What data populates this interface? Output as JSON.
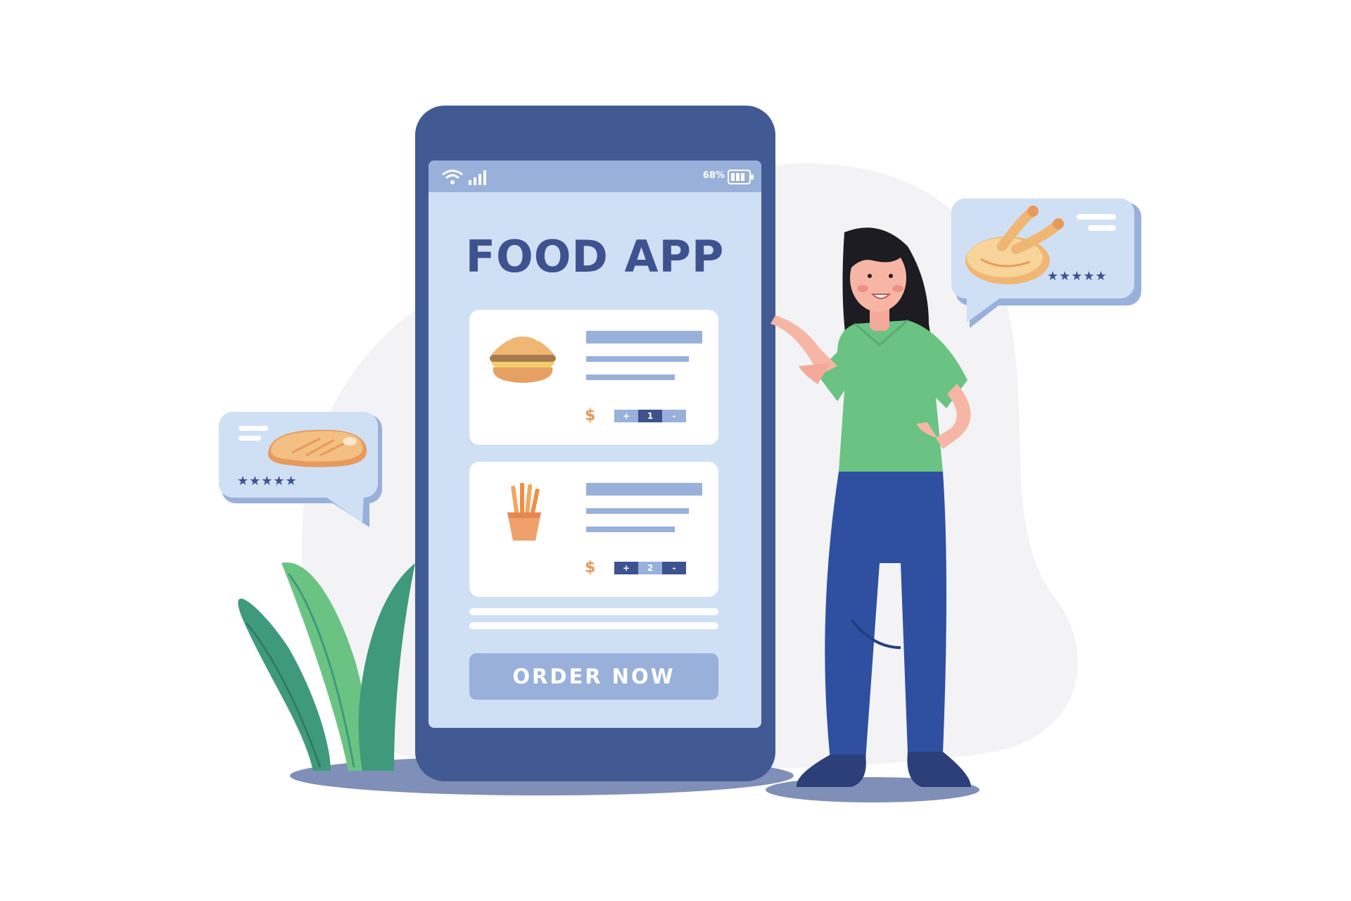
{
  "status_bar": {
    "battery": "68%"
  },
  "app": {
    "title": "FOOD APP",
    "order_button": "ORDER NOW"
  },
  "items": [
    {
      "name_icon": "burger-icon",
      "currency": "$",
      "quantity": "1",
      "plus": "+",
      "minus": "-"
    },
    {
      "name_icon": "fries-icon",
      "currency": "$",
      "quantity": "2",
      "plus": "+",
      "minus": "-"
    }
  ],
  "reviews": [
    {
      "icon": "steak-icon",
      "stars": "★★★★★"
    },
    {
      "icon": "roast-chicken-icon",
      "stars": "★★★★★"
    }
  ],
  "colors": {
    "phone": "#425a93",
    "screen": "#cfe0f5",
    "accent": "#98b0da",
    "title": "#3e5290",
    "shirt": "#6bc383",
    "pants": "#2f4fa0"
  }
}
